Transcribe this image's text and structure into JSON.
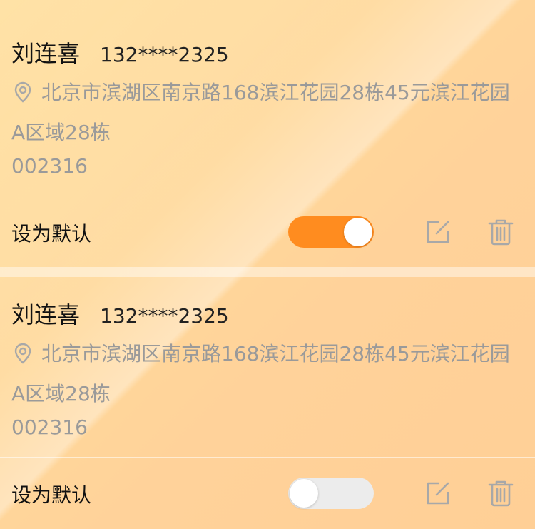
{
  "addresses": [
    {
      "name": "刘连喜",
      "phone": "132****2325",
      "address": "北京市滨湖区南京路168滨江花园28栋45元滨江花园A区域28栋",
      "zip": "002316",
      "default_label": "设为默认",
      "is_default": true
    },
    {
      "name": "刘连喜",
      "phone": "132****2325",
      "address": "北京市滨湖区南京路168滨江花园28栋45元滨江花园A区域28栋",
      "zip": "002316",
      "default_label": "设为默认",
      "is_default": false
    }
  ],
  "icons": {
    "location": "location-pin-icon",
    "edit": "edit-icon",
    "delete": "trash-icon"
  },
  "colors": {
    "toggle_on": "#ff8c1f",
    "toggle_off": "#ececec",
    "text_primary": "#111111",
    "text_secondary": "#9a9a9a"
  }
}
